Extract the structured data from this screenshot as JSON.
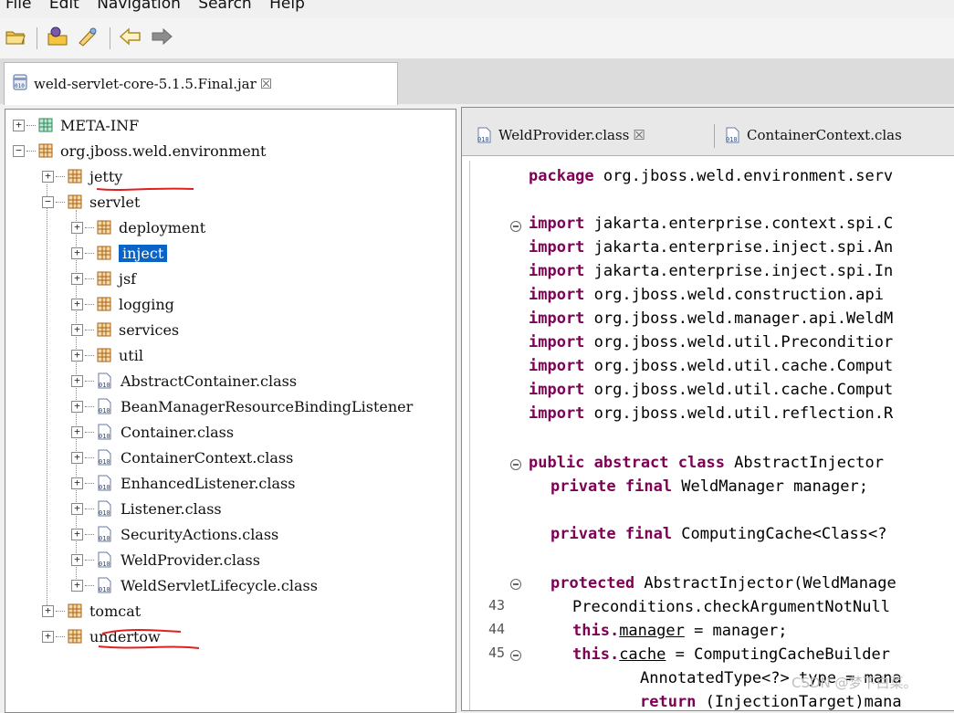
{
  "menu": [
    "File",
    "Edit",
    "Navigation",
    "Search",
    "Help"
  ],
  "jar_tab": {
    "label": "weld-servlet-core-5.1.5.Final.jar",
    "close": "☒"
  },
  "tree": {
    "meta_inf": "META-INF",
    "root_pkg": "org.jboss.weld.environment",
    "jetty": "jetty",
    "servlet": "servlet",
    "servlet_children": [
      "deployment",
      "inject",
      "jsf",
      "logging",
      "services",
      "util"
    ],
    "classes": [
      "AbstractContainer.class",
      "BeanManagerResourceBindingListener",
      "Container.class",
      "ContainerContext.class",
      "EnhancedListener.class",
      "Listener.class",
      "SecurityActions.class",
      "WeldProvider.class",
      "WeldServletLifecycle.class"
    ],
    "tomcat": "tomcat",
    "undertow": "undertow",
    "selected": "inject"
  },
  "code_tabs": [
    {
      "label": "WeldProvider.class",
      "close": "☒"
    },
    {
      "label": "ContainerContext.clas"
    }
  ],
  "code": {
    "package_kw": "package",
    "package_rest": " org.jboss.weld.environment.serv",
    "import_kw": "import",
    "imports": [
      " jakarta.enterprise.context.spi.C",
      " jakarta.enterprise.inject.spi.An",
      " jakarta.enterprise.inject.spi.In",
      " org.jboss.weld.construction.api",
      " org.jboss.weld.manager.api.WeldM",
      " org.jboss.weld.util.Preconditior",
      " org.jboss.weld.util.cache.Comput",
      " org.jboss.weld.util.cache.Comput",
      " org.jboss.weld.util.reflection.R"
    ],
    "class_decl_kw": "public abstract class",
    "class_decl_rest": " AbstractInjector",
    "field1_kw": "private final",
    "field1_rest": " WeldManager manager;",
    "field2_kw": "private final",
    "field2_rest": " ComputingCache<Class<?",
    "ctor_kw": "protected",
    "ctor_rest": " AbstractInjector(WeldManage",
    "line43": "Preconditions.checkArgumentNotNull",
    "line44_kw": "this.",
    "line44_field": "manager",
    "line44_rest": " = manager;",
    "line45_kw": "this.",
    "line45_field": "cache",
    "line45_rest": " = ComputingCacheBuilder",
    "line46": "AnnotatedType<?> type = mana",
    "line47_kw": "return",
    "line47_rest": " (InjectionTarget)mana",
    "line_numbers": [
      "43",
      "44",
      "45"
    ]
  },
  "watermark": "CSDN @梦下白菜。"
}
